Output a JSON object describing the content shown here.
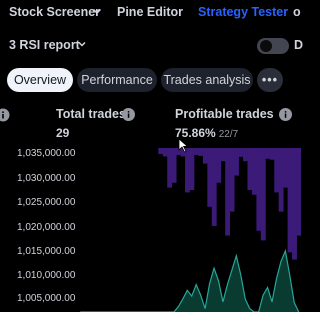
{
  "topnav": {
    "stock_screener": "Stock Screener",
    "pine_editor": "Pine Editor",
    "strategy_tester": "Strategy Tester",
    "partial_item": "o"
  },
  "report": {
    "title": "3 RSI report"
  },
  "toggle": {
    "letter": "D",
    "state": "off"
  },
  "tabs": [
    "Overview",
    "Performance",
    "Trades analysis"
  ],
  "more_label": "•••",
  "stats": {
    "total_trades": {
      "label": "Total trades",
      "value": "29"
    },
    "profitable_trades": {
      "label": "Profitable trades",
      "value": "75.86%",
      "sub": "22/7"
    }
  },
  "colors": {
    "background": "#000000",
    "accent": "#2962ff",
    "drawdown": "#3b1a78",
    "equity_fill": "#0a3b30",
    "equity_line": "#26a69a",
    "text": "#d1d4dc"
  },
  "chart_data": {
    "type": "area",
    "y_ticks": [
      "1,035,000.00",
      "1,030,000.00",
      "1,025,000.00",
      "1,020,000.00",
      "1,015,000.00",
      "1,010,000.00",
      "1,005,000.00"
    ],
    "ylim": [
      1002000,
      1037000
    ],
    "series": [
      {
        "values": [
          1002000,
          1002000,
          1002000,
          1002000,
          1002000,
          1002000,
          1002000,
          1002000,
          1002000,
          1002000,
          1002000,
          1002000,
          1002000,
          1002000,
          1002000,
          1002000,
          1002000,
          1002000,
          1002000,
          1002000,
          1002000,
          1002000,
          1003200,
          1004800,
          1006600,
          1005400,
          1007800,
          1005600,
          1002800,
          1008000,
          1011200,
          1008600,
          1004200,
          1007800,
          1010800,
          1013800,
          1009800,
          1004800,
          1002800,
          1002000,
          1002000,
          1005600,
          1007200,
          1004200,
          1009000,
          1012600,
          1014800,
          1009600,
          1004000,
          1002000
        ]
      },
      {
        "values": [
          0,
          0,
          0,
          0,
          0,
          0,
          0,
          0,
          0,
          0,
          0,
          0,
          0,
          0,
          0,
          0,
          0,
          0,
          1035000,
          1034500,
          1028000,
          1029000,
          1034800,
          1034500,
          1027000,
          1027500,
          1034800,
          1034600,
          1033000,
          1024000,
          1020000,
          1029000,
          1033500,
          1018000,
          1023000,
          1030500,
          1034400,
          1033500,
          1027500,
          1026500,
          1019000,
          1017000,
          1034000,
          1033800,
          1027000,
          1023000,
          1028000,
          1014500,
          1013000,
          1018000
        ]
      }
    ]
  }
}
